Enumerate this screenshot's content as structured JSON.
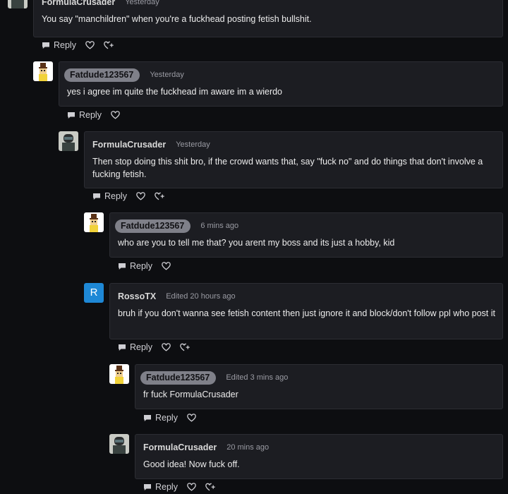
{
  "comments": [
    {
      "author": "FormulaCrusader",
      "time": "Yesterday",
      "text": "You say \"manchildren\" when you're a fuckhead posting fetish bullshit.",
      "avatar": "helmet-avatar",
      "reply": "Reply"
    },
    {
      "author": "Fatdude123567",
      "time": "Yesterday",
      "text": "yes i agree im quite the fuckhead im aware im a wierdo",
      "avatar": "tophat-avatar",
      "reply": "Reply"
    },
    {
      "author": "FormulaCrusader",
      "time": "Yesterday",
      "text": "Then stop doing this shit bro, if the crowd wants that, say \"fuck no\" and do things that don't involve a fucking fetish.",
      "avatar": "helmet-avatar",
      "reply": "Reply"
    },
    {
      "author": "Fatdude123567",
      "time": "6 mins ago",
      "text": "who are you to tell me that? you arent my boss and its just a hobby, kid",
      "avatar": "tophat-avatar",
      "reply": "Reply"
    },
    {
      "author": "RossoTX",
      "time": "Edited 20 hours ago",
      "text": "bruh if you don't wanna see fetish content then just ignore it and block/don't follow ppl who post it",
      "avatar": "letter-avatar",
      "avatar_letter": "R",
      "reply": "Reply"
    },
    {
      "author": "Fatdude123567",
      "time": "Edited 3 mins ago",
      "text": "fr fuck FormulaCrusader",
      "avatar": "tophat-avatar",
      "reply": "Reply"
    },
    {
      "author": "FormulaCrusader",
      "time": "20 mins ago",
      "text": "Good idea! Now fuck off.",
      "avatar": "helmet-avatar",
      "reply": "Reply"
    }
  ],
  "colors": {
    "background": "#0d0e11",
    "card": "#1c1d22",
    "card_border": "#2c2d33",
    "author_pill": "#7f8089",
    "letter_avatar": "#1e88d6"
  }
}
